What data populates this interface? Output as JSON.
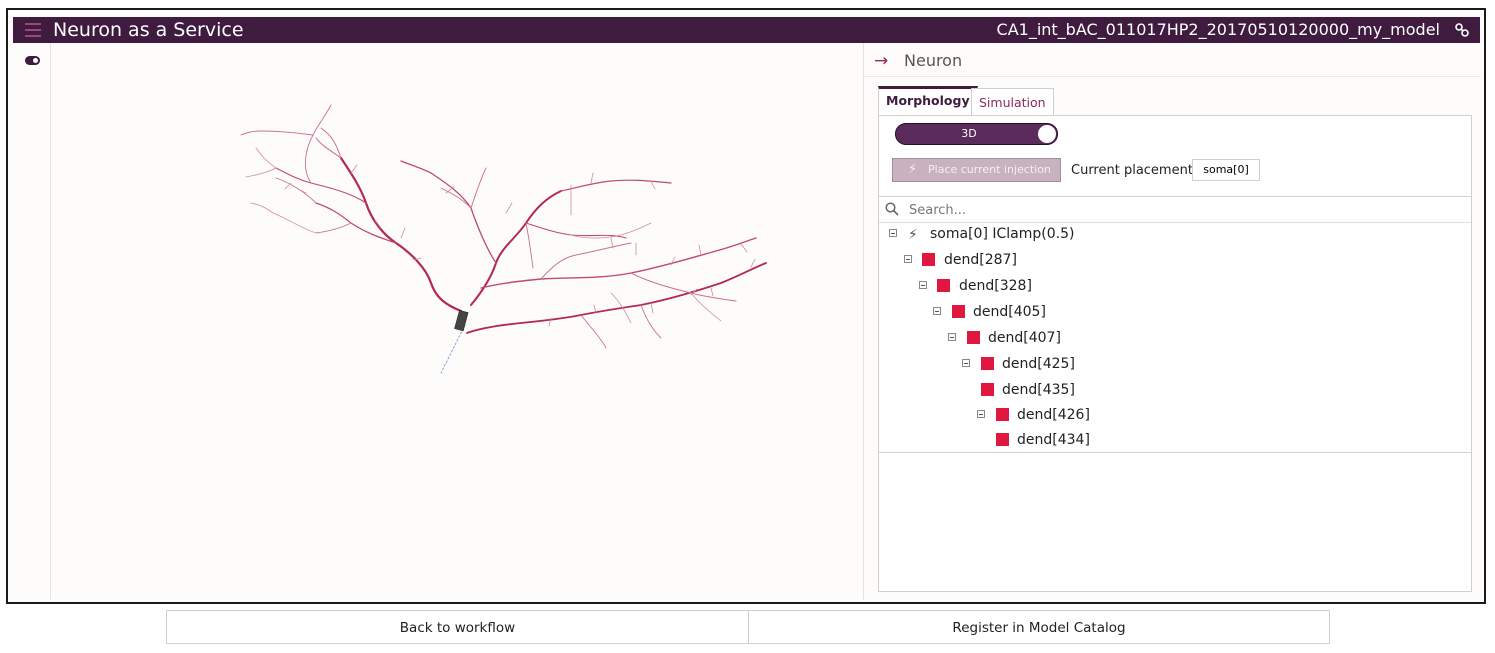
{
  "header": {
    "app_title": "Neuron as a Service",
    "model_name": "CA1_int_bAC_011017HP2_20170510120000_my_model"
  },
  "panel": {
    "title": "Neuron",
    "tabs": [
      {
        "label": "Morphology",
        "active": true
      },
      {
        "label": "Simulation",
        "active": false
      }
    ],
    "view_toggle_label": "3D",
    "place_injection_label": "Place current injection",
    "current_placement_label": "Current placement:",
    "current_placement_value": "soma[0]",
    "search_placeholder": "Search...",
    "tree": [
      {
        "label": "soma[0] IClamp(0.5)",
        "depth": 0,
        "icon": "bolt-icon",
        "expanded": true
      },
      {
        "label": "dend[287]",
        "depth": 1,
        "icon": "section-square",
        "expanded": true
      },
      {
        "label": "dend[328]",
        "depth": 2,
        "icon": "section-square",
        "expanded": true
      },
      {
        "label": "dend[405]",
        "depth": 3,
        "icon": "section-square",
        "expanded": true
      },
      {
        "label": "dend[407]",
        "depth": 4,
        "icon": "section-square",
        "expanded": true
      },
      {
        "label": "dend[425]",
        "depth": 5,
        "icon": "section-square",
        "expanded": true
      },
      {
        "label": "dend[435]",
        "depth": 5,
        "icon": "section-square",
        "expanded": null
      },
      {
        "label": "dend[426]",
        "depth": 6,
        "icon": "section-square",
        "expanded": true
      },
      {
        "label": "dend[434]",
        "depth": 6,
        "icon": "section-square",
        "expanded": null
      }
    ]
  },
  "footer": {
    "back_label": "Back to workflow",
    "register_label": "Register in Model Catalog"
  },
  "colors": {
    "brand": "#3f1b40",
    "section": "#e0173f",
    "dendrite": "#c04a6a"
  }
}
